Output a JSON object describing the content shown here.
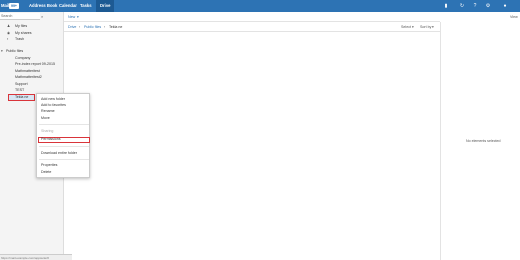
{
  "topbar": {
    "app_label": "Mail",
    "badge": "99+",
    "tabs": [
      "Address Book",
      "Calendar",
      "Tasks",
      "Drive"
    ],
    "active_tab": "Drive"
  },
  "sidebar": {
    "search_placeholder": "Search",
    "my_files": "My files",
    "my_shares": "My shares",
    "trash": "Trash",
    "public_files": "Public files",
    "folders": [
      "Company",
      "Pre-index report 09-2015",
      "Mathmatteritest",
      "Mathmatteritest2",
      "Support",
      "TEST",
      "Tekla ne"
    ]
  },
  "toolbar": {
    "new_label": "New",
    "view_label": "View"
  },
  "breadcrumb": {
    "root": "Drive",
    "parent": "Public files",
    "current": "Tekla ne"
  },
  "listing": {
    "select_label": "Select",
    "sort_label": "Sort by"
  },
  "context_menu": {
    "items": [
      "Add new folder",
      "Add to favorites",
      "Rename",
      "Move"
    ],
    "sharing_header": "Sharing",
    "permissions": "Permissions",
    "download": "Download entire folder",
    "properties": "Properties",
    "delete": "Delete"
  },
  "detail_panel": {
    "empty_text": "No elements selected"
  },
  "statusbar": {
    "url": "https://mail.example.com/appsuite/#"
  }
}
